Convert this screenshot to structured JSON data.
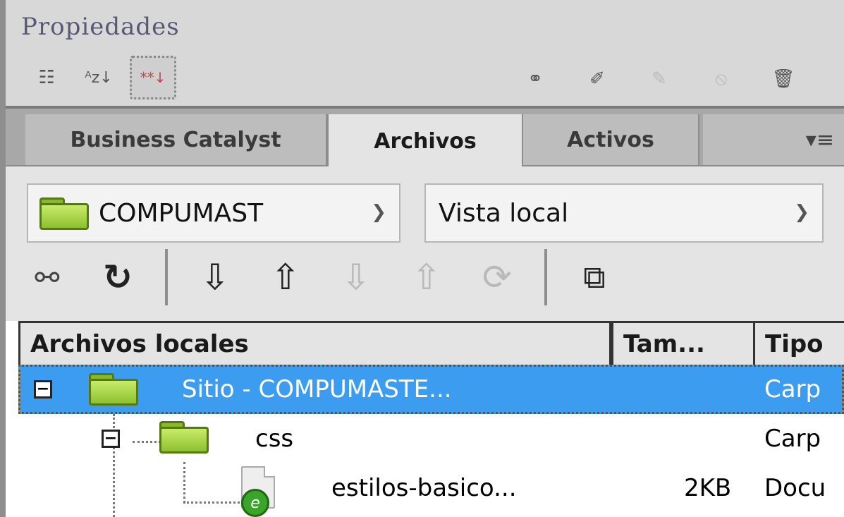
{
  "properties_panel": {
    "title": "Propiedades",
    "tools_left": [
      "category-view-icon",
      "sort-az-icon",
      "set-properties-icon"
    ],
    "tools_right": [
      "link-icon",
      "edit-rule-icon",
      "pencil-icon",
      "disable-icon",
      "trash-icon"
    ]
  },
  "tabs": [
    {
      "label": "Business Catalyst",
      "active": false
    },
    {
      "label": "Archivos",
      "active": true
    },
    {
      "label": "Activos",
      "active": false
    }
  ],
  "tab_menu_icon": "▾≡",
  "site_select": {
    "value": "COMPUMAST"
  },
  "view_select": {
    "value": "Vista local"
  },
  "toolbar": {
    "connect": "connect-icon",
    "refresh": "refresh-icon",
    "get": "get-files-icon",
    "put": "put-files-icon",
    "checkout": "check-out-icon",
    "checkin": "check-in-icon",
    "sync": "synchronize-icon",
    "expand": "expand-panel-icon"
  },
  "file_table": {
    "columns": [
      "Archivos locales",
      "Tam...",
      "Tipo"
    ],
    "rows": [
      {
        "name": "Sitio - COMPUMASTE...",
        "size": "",
        "type": "Carp",
        "selected": true
      },
      {
        "name": "css",
        "size": "",
        "type": "Carp",
        "selected": false
      },
      {
        "name": "estilos-basico...",
        "size": "2KB",
        "type": "Docu",
        "selected": false
      }
    ]
  },
  "colors": {
    "selection": "#3c9cef",
    "folder_green": "#8dc030",
    "panel_bg": "#e4e4e4"
  }
}
